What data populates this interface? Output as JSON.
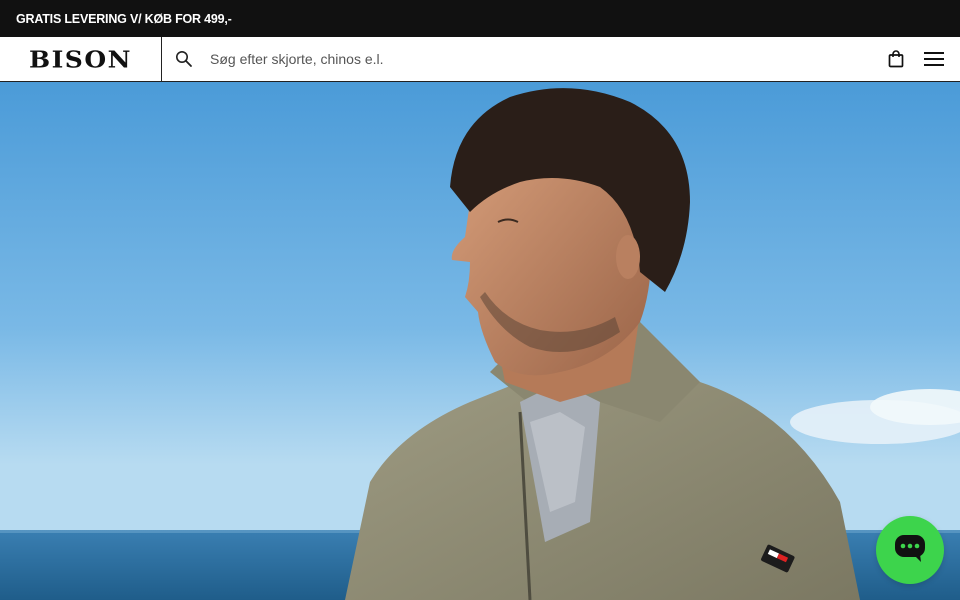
{
  "announcement": {
    "text": "GRATIS LEVERING V/ KØB FOR 499,-"
  },
  "header": {
    "logo_text": "BISON",
    "search_placeholder": "Søg efter skjorte, chinos e.l.",
    "icons": {
      "search": "search-icon",
      "bag": "shopping-bag-icon",
      "menu": "hamburger-menu-icon"
    }
  },
  "hero": {
    "description": "hero-banner-photo",
    "colors": {
      "sky_top": "#4a9ad6",
      "sky_bottom": "#a9d3ee",
      "sea": "#2a6f9e",
      "sweater": "#8f8c73"
    }
  },
  "chat": {
    "icon": "chat-bubble-icon",
    "color": "#3dd44c"
  }
}
